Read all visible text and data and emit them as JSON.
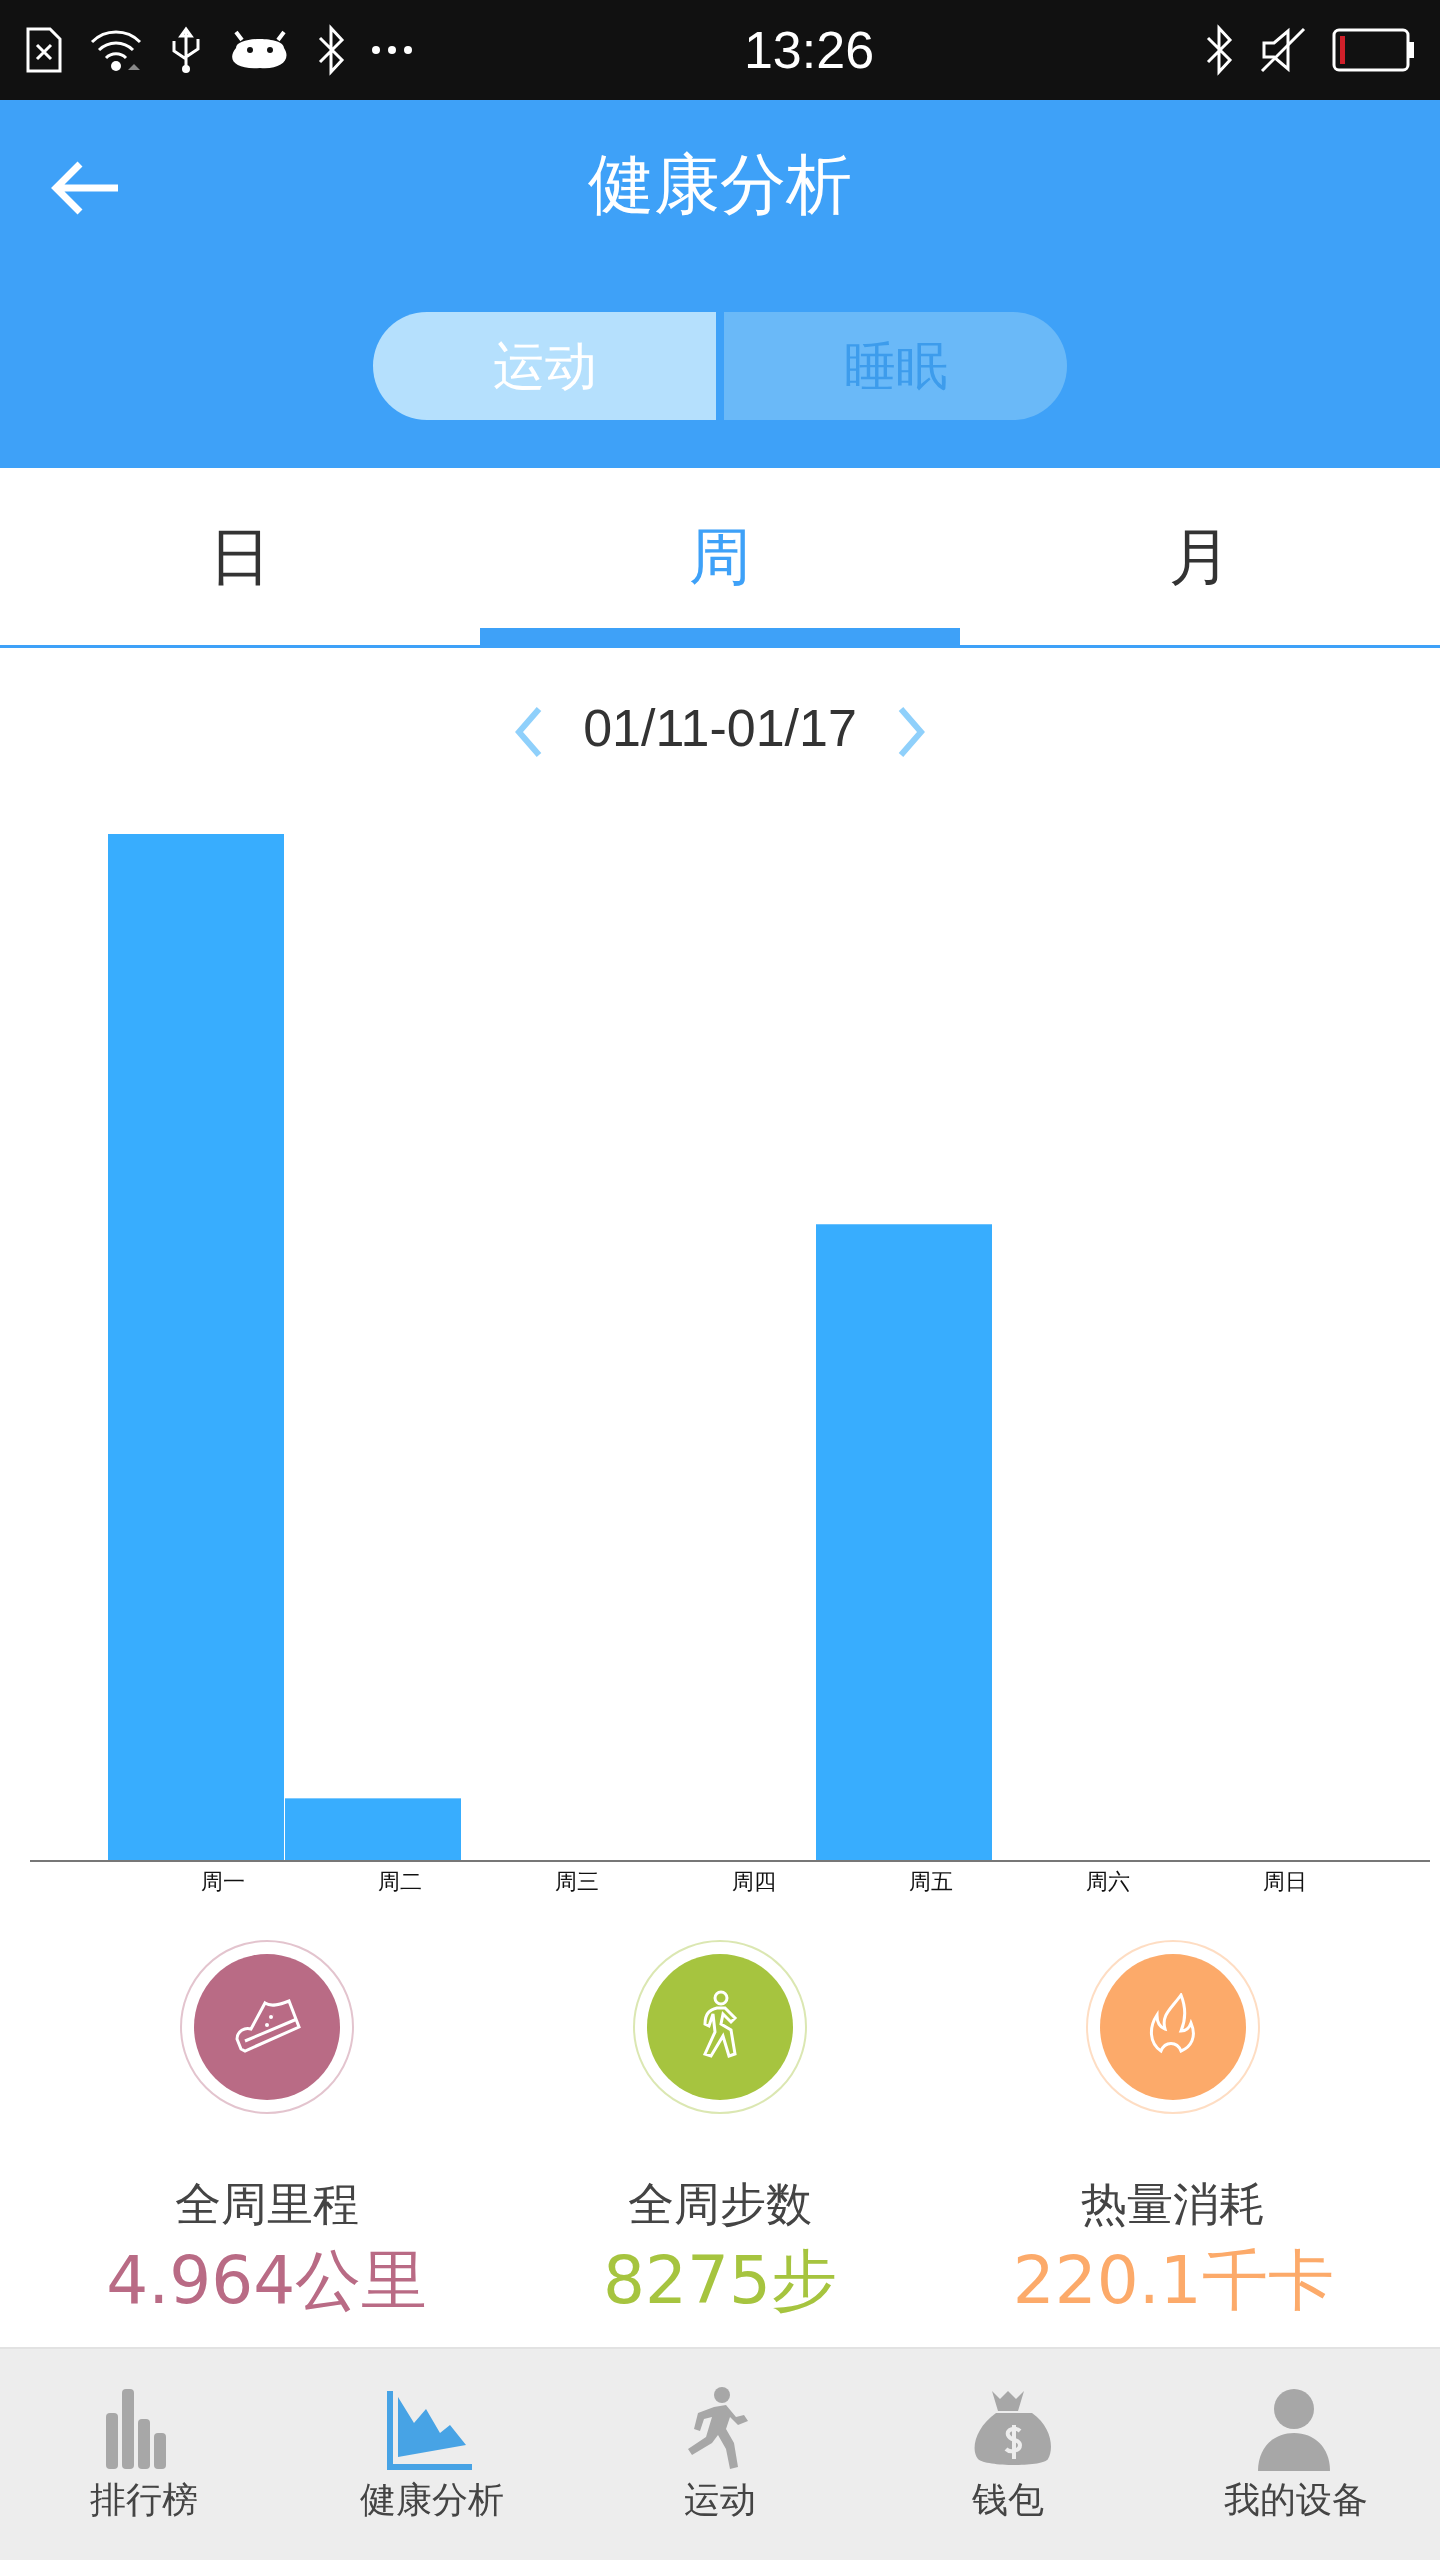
{
  "status_bar": {
    "time": "13:26"
  },
  "header": {
    "title": "健康分析"
  },
  "mode_tabs": [
    {
      "label": "运动",
      "selected": true
    },
    {
      "label": "睡眠",
      "selected": false
    }
  ],
  "period_tabs": [
    {
      "label": "日",
      "selected": false
    },
    {
      "label": "周",
      "selected": true
    },
    {
      "label": "月",
      "selected": false
    }
  ],
  "date_range": "01/11-01/17",
  "chart": {
    "day_labels": [
      "周一",
      "周二",
      "周三",
      "周四",
      "周五",
      "周六",
      "周日"
    ]
  },
  "stats": [
    {
      "kind": "distance",
      "label": "全周里程",
      "value": "4.964公里",
      "color": "#b96b85"
    },
    {
      "kind": "steps",
      "label": "全周步数",
      "value": "8275步",
      "color": "#a6c43f"
    },
    {
      "kind": "calories",
      "label": "热量消耗",
      "value": "220.1千卡",
      "color": "#fcaa6a"
    }
  ],
  "bottom_nav": [
    {
      "kind": "ranking",
      "label": "排行榜",
      "selected": false
    },
    {
      "kind": "analysis",
      "label": "健康分析",
      "selected": true
    },
    {
      "kind": "sport",
      "label": "运动",
      "selected": false
    },
    {
      "kind": "wallet",
      "label": "钱包",
      "selected": false
    },
    {
      "kind": "device",
      "label": "我的设备",
      "selected": false
    }
  ]
}
